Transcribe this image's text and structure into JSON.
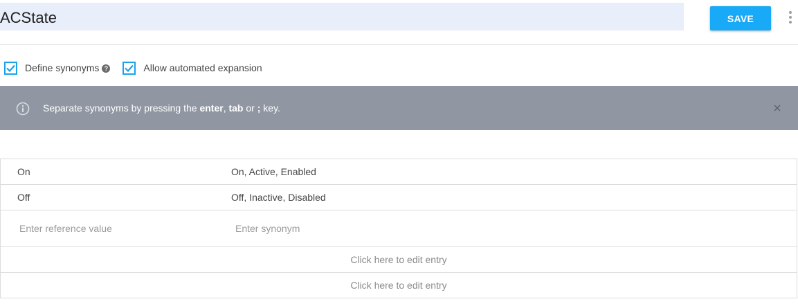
{
  "header": {
    "title": "ACState",
    "save_label": "SAVE"
  },
  "options": {
    "define_synonyms_label": "Define synonyms",
    "define_synonyms_checked": true,
    "help_glyph": "?",
    "allow_expansion_label": "Allow automated expansion",
    "allow_expansion_checked": true
  },
  "banner": {
    "text_prefix": "Separate synonyms by pressing the ",
    "key_enter": "enter",
    "sep1": ", ",
    "key_tab": "tab",
    "sep2": " or ",
    "key_semicolon": ";",
    "text_suffix": " key."
  },
  "entries": [
    {
      "reference": "On",
      "synonyms": "On, Active, Enabled"
    },
    {
      "reference": "Off",
      "synonyms": "Off, Inactive, Disabled"
    }
  ],
  "new_entry": {
    "reference_placeholder": "Enter reference value",
    "synonym_placeholder": "Enter synonym"
  },
  "edit_rows": [
    {
      "label": "Click here to edit entry"
    },
    {
      "label": "Click here to edit entry"
    }
  ],
  "colors": {
    "accent": "#18a9f7",
    "banner_bg": "#9097a3",
    "title_bg": "#e8eefa"
  }
}
